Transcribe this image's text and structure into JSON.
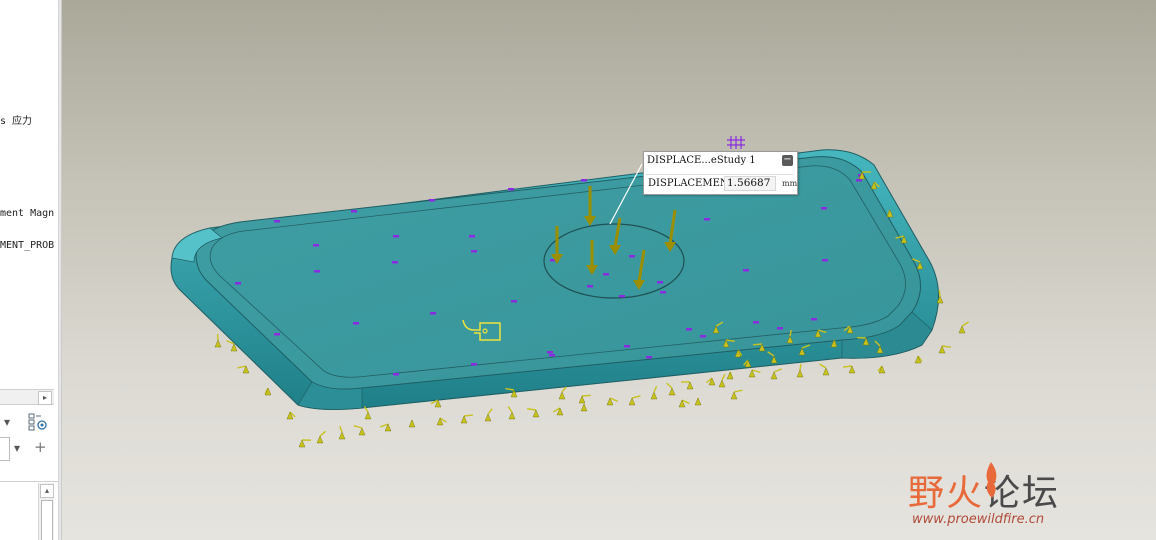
{
  "model_tree": {
    "rows": [
      "s 应力",
      "ment Magn",
      "MENT_PROB"
    ]
  },
  "toolbar": {
    "dropdown_glyph": "▾",
    "add_glyph": "+",
    "scroll_right_glyph": "▸",
    "scroll_up_glyph": "▴"
  },
  "result_box": {
    "title": "DISPLACE...eStudy 1",
    "collapse_glyph": "−",
    "quantity_label": "DISPLACEMENT",
    "value": "1.56687",
    "unit": "mm"
  },
  "watermark": {
    "title_left": "野火",
    "title_right": "论坛",
    "url": "www.proewildfire.cn"
  },
  "colors": {
    "part_fill": "#3b9aa0",
    "part_edge": "#1f5e63",
    "constraint_arrows": "#c8c21c",
    "load_arrows": "#9b8f00",
    "mesh_markers": "#8a2be2",
    "viewport_top": "#a9a899",
    "viewport_bottom": "#e6e4de"
  },
  "icons": [
    "dropdown-arrow-icon",
    "filter-icon",
    "add-icon",
    "collapse-icon",
    "probe-tag-icon",
    "mesh-marker-icon"
  ]
}
